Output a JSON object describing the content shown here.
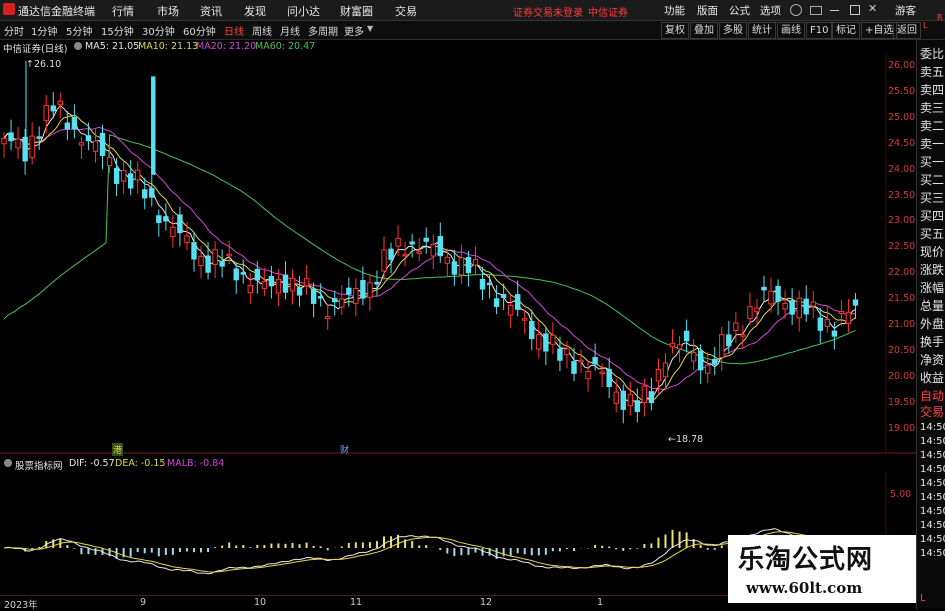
{
  "titlebar": {
    "app_title": "通达信金融终端",
    "menus": [
      "行情",
      "市场",
      "资讯",
      "发现",
      "问小达",
      "财富圈",
      "交易"
    ],
    "login_status": "证券交易未登录",
    "broker": "中信证券",
    "right_menus": [
      "功能",
      "版面",
      "公式",
      "选项"
    ],
    "user": "游客"
  },
  "toolbar": {
    "periods": [
      "分时",
      "1分钟",
      "5分钟",
      "15分钟",
      "30分钟",
      "60分钟",
      "日线",
      "周线",
      "月线",
      "多周期",
      "更多"
    ],
    "active_period": "日线",
    "right_buttons": [
      "复权",
      "叠加",
      "多股",
      "统计",
      "画线",
      "F10",
      "标记",
      "+自选",
      "返回"
    ]
  },
  "legend": {
    "stock": "中信证券(日线)",
    "ma5": "MA5: 21.05",
    "ma10": "MA10: 21.13",
    "ma20": "MA20: 21.20",
    "ma60": "MA60: 20.47"
  },
  "colors": {
    "up": "#ff3333",
    "down": "#59e0f0",
    "ma5": "#e8e8e8",
    "ma10": "#e6d64a",
    "ma20": "#d04ad6",
    "ma60": "#48c25a",
    "axis": "#d23a3a"
  },
  "price_axis": [
    "26.00",
    "25.50",
    "25.00",
    "24.50",
    "24.00",
    "23.50",
    "23.00",
    "22.50",
    "22.00",
    "21.50",
    "21.00",
    "20.50",
    "20.00",
    "19.50",
    "19.00"
  ],
  "annotations": {
    "high": "26.10",
    "low": "18.78",
    "marker1": "港",
    "marker2": "财"
  },
  "indicator": {
    "name": "股票指标网",
    "dif": "DIF: -0.57",
    "dea": "DEA: -0.15",
    "macd": "MALB: -0.84",
    "axis_label": "5.00"
  },
  "x_axis": [
    "2023年",
    "9",
    "10",
    "11",
    "12",
    "1"
  ],
  "right_panel": {
    "top_letters": [
      "L",
      "R"
    ],
    "items": [
      "委比",
      "卖五",
      "卖四",
      "卖三",
      "卖二",
      "卖一",
      "买一",
      "买二",
      "买三",
      "买四",
      "买五",
      "现价",
      "涨跌",
      "涨幅",
      "总量",
      "外盘",
      "换手",
      "净资",
      "收益",
      "自动",
      "交易"
    ],
    "times": [
      "14:50",
      "14:50",
      "14:50",
      "14:50",
      "14:50",
      "14:50",
      "14:50",
      "14:50",
      "14:50",
      "14:50"
    ],
    "extra": "L"
  },
  "watermark": {
    "title": "乐淘公式网",
    "url": "www.60lt.com"
  }
}
